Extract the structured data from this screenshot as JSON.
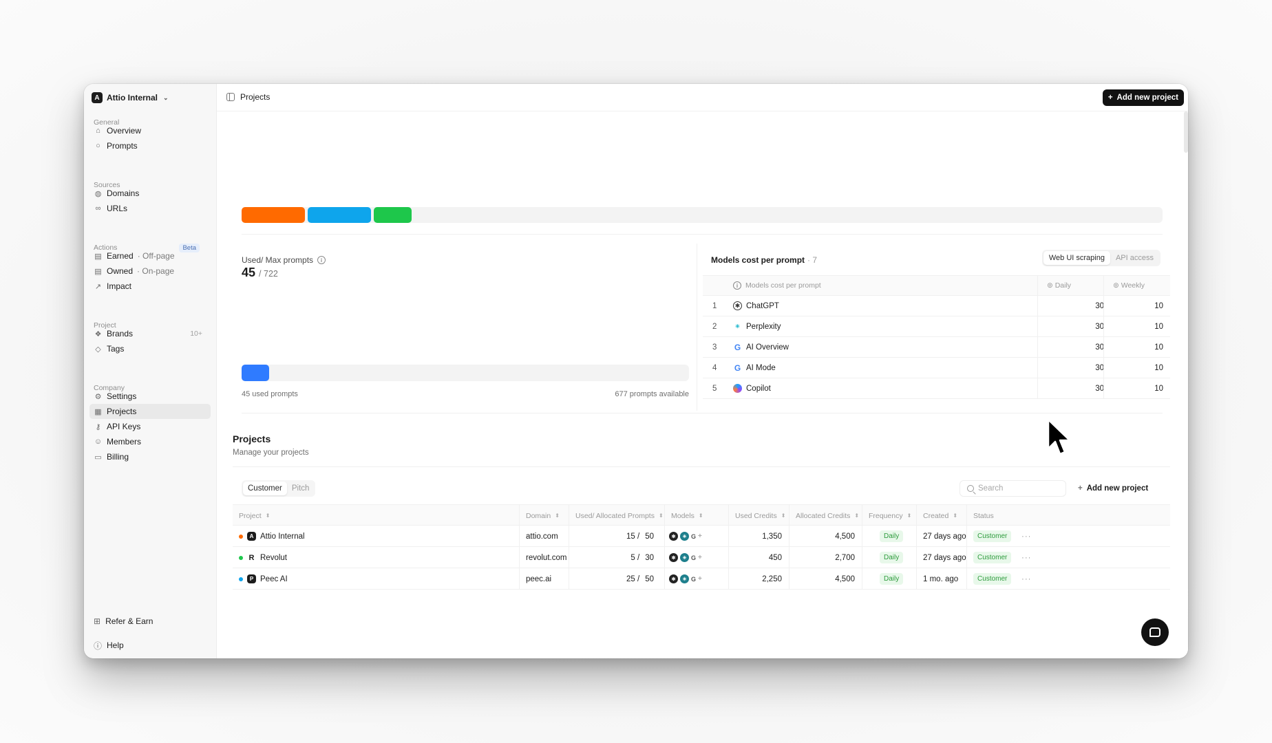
{
  "app": {
    "workspace": "Attio Internal",
    "breadcrumb": "Projects",
    "add_project_label": "Add new project"
  },
  "sidebar": {
    "sections": [
      {
        "title": "General",
        "items": [
          {
            "label": "Overview",
            "icon": "home-icon"
          },
          {
            "label": "Prompts",
            "icon": "chat-icon"
          }
        ]
      },
      {
        "title": "Sources",
        "items": [
          {
            "label": "Domains",
            "icon": "globe-icon"
          },
          {
            "label": "URLs",
            "icon": "link-icon"
          }
        ]
      },
      {
        "title": "Actions",
        "badge": "Beta",
        "items": [
          {
            "label": "Earned",
            "sub": "· Off-page",
            "icon": "doc-icon"
          },
          {
            "label": "Owned",
            "sub": "· On-page",
            "icon": "doc-icon"
          },
          {
            "label": "Impact",
            "icon": "trend-icon"
          }
        ]
      },
      {
        "title": "Project",
        "items": [
          {
            "label": "Brands",
            "count": "10+",
            "icon": "brand-icon"
          },
          {
            "label": "Tags",
            "icon": "tag-icon"
          }
        ]
      },
      {
        "title": "Company",
        "items": [
          {
            "label": "Settings",
            "icon": "gear-icon"
          },
          {
            "label": "Projects",
            "icon": "projects-icon"
          },
          {
            "label": "API Keys",
            "icon": "key-icon"
          },
          {
            "label": "Members",
            "icon": "users-icon"
          },
          {
            "label": "Billing",
            "icon": "card-icon"
          }
        ]
      }
    ],
    "bottom": [
      {
        "label": "Refer & Earn",
        "icon": "gift-icon"
      },
      {
        "label": "Help",
        "icon": "help-icon"
      }
    ]
  },
  "usage": {
    "stacked_colors": [
      "#ff6a00",
      "#0ea5ec",
      "#1ec74b"
    ],
    "title": "Used/ Max prompts",
    "used": "45",
    "max": "/ 722",
    "used_fraction": 0.062,
    "used_label": "45 used prompts",
    "available_label": "677 prompts available",
    "bar_color": "#2f7bff"
  },
  "models": {
    "title": "Models cost per prompt",
    "count": "· 7",
    "toggle": [
      "Web UI scraping",
      "API access"
    ],
    "headers": {
      "name": "Models cost per prompt",
      "daily": "Daily",
      "weekly": "Weekly"
    },
    "rows": [
      {
        "n": "1",
        "name": "ChatGPT",
        "daily": "30",
        "weekly": "10",
        "icon": "chatgpt-icon"
      },
      {
        "n": "2",
        "name": "Perplexity",
        "daily": "30",
        "weekly": "10",
        "icon": "perplexity-icon"
      },
      {
        "n": "3",
        "name": "AI Overview",
        "daily": "30",
        "weekly": "10",
        "icon": "google-icon"
      },
      {
        "n": "4",
        "name": "AI Mode",
        "daily": "30",
        "weekly": "10",
        "icon": "google-icon"
      },
      {
        "n": "5",
        "name": "Copilot",
        "daily": "30",
        "weekly": "10",
        "icon": "copilot-icon"
      }
    ]
  },
  "projects": {
    "title": "Projects",
    "subtitle": "Manage your projects",
    "tabs": [
      "Customer",
      "Pitch"
    ],
    "search_placeholder": "Search",
    "add_label": "Add new project",
    "headers": [
      "Project",
      "Domain",
      "Used/ Allocated Prompts",
      "Models",
      "Used Credits",
      "Allocated Credits",
      "Frequency",
      "Created",
      "Status"
    ],
    "rows": [
      {
        "dot": "#ff6a00",
        "logo": "A",
        "name": "Attio Internal",
        "domain": "attio.com",
        "used": "15 /",
        "alloc": "50",
        "used_credits": "1,350",
        "alloc_credits": "4,500",
        "frequency": "Daily",
        "created": "27 days ago",
        "status": "Customer"
      },
      {
        "dot": "#1ec74b",
        "logo": "R",
        "name": "Revolut",
        "domain": "revolut.com",
        "used": "5 /",
        "alloc": "30",
        "used_credits": "450",
        "alloc_credits": "2,700",
        "frequency": "Daily",
        "created": "27 days ago",
        "status": "Customer"
      },
      {
        "dot": "#0ea5ec",
        "logo": "P",
        "name": "Peec AI",
        "domain": "peec.ai",
        "used": "25 /",
        "alloc": "50",
        "used_credits": "2,250",
        "alloc_credits": "4,500",
        "frequency": "Daily",
        "created": "1 mo. ago",
        "status": "Customer"
      }
    ]
  }
}
